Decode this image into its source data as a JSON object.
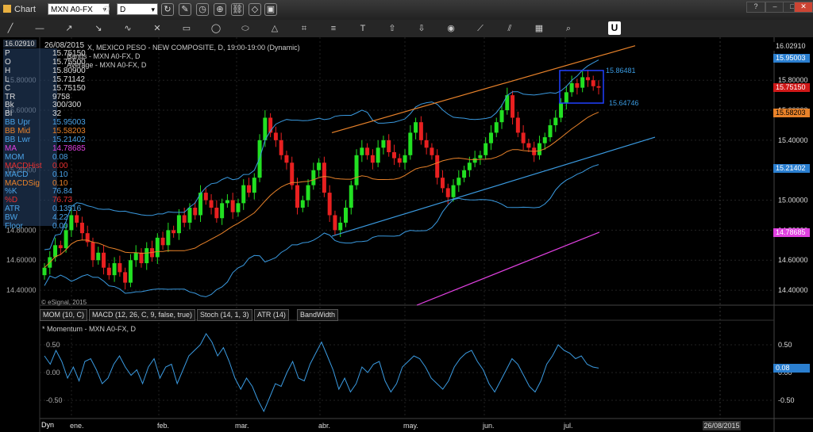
{
  "window": {
    "title": "Chart"
  },
  "toolbar": {
    "symbol": "MXN A0-FX",
    "interval": "D",
    "u_label": "U",
    "tool_icons": [
      "pencil-icon",
      "line-icon",
      "ray-icon",
      "arrow-icon",
      "curve-icon",
      "cross-icon",
      "rect-icon",
      "circle-icon",
      "ellipse-icon",
      "triangle-icon",
      "gann-icon",
      "fib-icon",
      "text-icon",
      "arrow-up-icon",
      "arrow-down-icon",
      "camera-icon",
      "trend-icon",
      "channel-icon",
      "box-icon",
      "zoom-icon"
    ]
  },
  "header": {
    "date": "26/08/2015",
    "top_price": "16.02910",
    "study_line1": "X, MEXICO PESO - NEW COMPOSITE, D, 19:00-19:00 (Dynamic)",
    "study_line2": "Bands - MXN A0-FX, D",
    "study_line3": "Average - MXN A0-FX, D",
    "watermark": "© eSignal, 2015"
  },
  "indicators": [
    {
      "label": "P",
      "value": "15.75150",
      "color": "#ddd"
    },
    {
      "label": "O",
      "value": "15.75500",
      "color": "#ddd"
    },
    {
      "label": "H",
      "value": "15.80900",
      "color": "#ddd"
    },
    {
      "label": "L",
      "value": "15.71142",
      "color": "#ddd"
    },
    {
      "label": "C",
      "value": "15.75150",
      "color": "#ddd"
    },
    {
      "label": "TR",
      "value": "9758",
      "color": "#ddd"
    },
    {
      "label": "Bk",
      "value": "300/300",
      "color": "#ddd"
    },
    {
      "label": "BI",
      "value": "32",
      "color": "#ddd"
    },
    {
      "label": "BB Upr",
      "value": "15.95003",
      "color": "#4aa3e8"
    },
    {
      "label": "BB Mid",
      "value": "15.58203",
      "color": "#e8822a"
    },
    {
      "label": "BB Lwr",
      "value": "15.21402",
      "color": "#4aa3e8"
    },
    {
      "label": "MA",
      "value": "14.78685",
      "color": "#e040e0"
    },
    {
      "label": "MOM",
      "value": "0.08",
      "color": "#4aa3e8"
    },
    {
      "label": "MACDHist",
      "value": "0.00",
      "color": "#e83030"
    },
    {
      "label": "MACD",
      "value": "0.10",
      "color": "#4aa3e8"
    },
    {
      "label": "MACDSig",
      "value": "0.10",
      "color": "#e8822a"
    },
    {
      "label": "%K",
      "value": "76.84",
      "color": "#4aa3e8"
    },
    {
      "label": "%D",
      "value": "76.73",
      "color": "#e83030"
    },
    {
      "label": "ATR",
      "value": "0.13516",
      "color": "#4aa3e8"
    },
    {
      "label": "BW",
      "value": "4.22",
      "color": "#4aa3e8"
    },
    {
      "label": "Floor",
      "value": "0.00",
      "color": "#4aa3e8"
    }
  ],
  "price_axis": {
    "ticks": [
      "15.80000",
      "15.60000",
      "15.40000",
      "15.20000",
      "15.00000",
      "14.80000",
      "14.60000",
      "14.40000"
    ],
    "left_ticks": [
      "15.80000",
      "15.60000",
      "15.20000",
      "14.80000",
      "14.60000",
      "14.40000"
    ]
  },
  "price_labels": [
    {
      "text": "16.02910",
      "value": 16.0291,
      "bg": "#000",
      "fg": "#ddd"
    },
    {
      "text": "15.95003",
      "value": 15.95003,
      "bg": "#2b7fd0",
      "fg": "#fff"
    },
    {
      "text": "15.75150",
      "value": 15.7515,
      "bg": "#d01818",
      "fg": "#fff"
    },
    {
      "text": "15.58203",
      "value": 15.58203,
      "bg": "#e8822a",
      "fg": "#000"
    },
    {
      "text": "15.21402",
      "value": 15.21402,
      "bg": "#2b7fd0",
      "fg": "#fff"
    },
    {
      "text": "14.78685",
      "value": 14.78685,
      "bg": "#e040e0",
      "fg": "#fff"
    }
  ],
  "box_labels": {
    "high": "15.86481",
    "low": "15.64746"
  },
  "tabs": [
    "MOM (10, C)",
    "MACD (12, 26, C, 9, false, true)",
    "Stoch (14, 1, 3)",
    "ATR (14)",
    "BandWidth"
  ],
  "sub_panel": {
    "title": "* Momentum - MXN A0-FX, D",
    "ticks": [
      "0.50",
      "0.00",
      "-0.50"
    ],
    "current": "0.08"
  },
  "time_axis": {
    "dyn": "Dyn",
    "months": [
      "ene.",
      "feb.",
      "mar.",
      "abr.",
      "may.",
      "jun.",
      "jul."
    ],
    "current_date": "26/08/2015"
  },
  "chart_data": {
    "type": "candlestick",
    "symbol": "MXN A0-FX",
    "yrange": [
      14.3,
      16.06
    ],
    "candles_close": [
      14.55,
      14.62,
      14.7,
      14.68,
      14.8,
      14.9,
      14.85,
      14.78,
      14.72,
      14.6,
      14.65,
      14.55,
      14.5,
      14.58,
      14.52,
      14.45,
      14.6,
      14.65,
      14.58,
      14.68,
      14.62,
      14.75,
      14.7,
      14.8,
      14.78,
      14.9,
      14.85,
      14.95,
      14.9,
      15.05,
      15.0,
      14.95,
      14.88,
      14.98,
      15.0,
      14.92,
      14.98,
      15.1,
      15.05,
      15.15,
      15.4,
      15.55,
      15.45,
      15.4,
      15.3,
      15.25,
      15.1,
      14.95,
      15.0,
      15.1,
      15.2,
      15.25,
      15.05,
      14.9,
      14.8,
      14.85,
      14.95,
      15.1,
      15.3,
      15.35,
      15.3,
      15.25,
      15.35,
      15.4,
      15.32,
      15.28,
      15.25,
      15.3,
      15.45,
      15.52,
      15.4,
      15.35,
      15.3,
      15.15,
      15.08,
      15.02,
      15.1,
      15.15,
      15.2,
      15.25,
      15.28,
      15.3,
      15.38,
      15.45,
      15.52,
      15.6,
      15.7,
      15.55,
      15.45,
      15.38,
      15.35,
      15.3,
      15.38,
      15.42,
      15.5,
      15.55,
      15.65,
      15.72,
      15.78,
      15.75,
      15.82,
      15.8,
      15.76,
      15.75
    ],
    "momentum": [
      0.3,
      0.15,
      0.4,
      0.2,
      -0.1,
      0.1,
      -0.15,
      0.2,
      0.25,
      0.05,
      -0.2,
      -0.1,
      0.15,
      0.3,
      0.1,
      -0.05,
      0.05,
      -0.2,
      0.1,
      0.25,
      -0.1,
      0.1,
      0.15,
      -0.2,
      0.05,
      0.3,
      0.4,
      0.5,
      0.7,
      0.55,
      0.3,
      0.45,
      0.2,
      -0.1,
      -0.3,
      -0.1,
      -0.25,
      -0.5,
      -0.7,
      -0.45,
      -0.2,
      -0.25,
      0.0,
      0.2,
      -0.1,
      -0.15,
      0.15,
      0.35,
      0.55,
      0.3,
      0.05,
      -0.3,
      -0.1,
      -0.35,
      -0.2,
      0.1,
      0.0,
      0.15,
      0.2,
      -0.15,
      -0.35,
      -0.2,
      0.1,
      0.2,
      0.3,
      0.25,
      0.1,
      -0.1,
      -0.2,
      -0.3,
      -0.15,
      0.1,
      0.25,
      0.35,
      0.4,
      0.2,
      0.05,
      -0.2,
      -0.35,
      -0.15,
      0.05,
      0.25,
      0.15,
      -0.05,
      -0.25,
      -0.35,
      -0.15,
      0.15,
      0.3,
      0.5,
      0.4,
      0.35,
      0.25,
      0.3,
      0.15,
      0.1,
      0.08
    ]
  }
}
